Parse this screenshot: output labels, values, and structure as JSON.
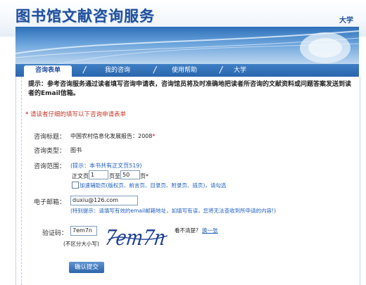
{
  "header": {
    "logo_text": "图书馆文献咨询服务",
    "university_label": "大学"
  },
  "nav": {
    "tabs": [
      {
        "label": "咨询表单",
        "active": true
      },
      {
        "label": "我的咨询",
        "active": false
      },
      {
        "label": "使用帮助",
        "active": false
      },
      {
        "label": "大学",
        "active": false
      }
    ]
  },
  "hint": {
    "text": "提示：参考咨询服务通过读者填写咨询申请表，咨询馆员将及时准确地把读者所咨询的文献资料或问题答案发送到读者的Email信箱。"
  },
  "notice": {
    "asterisk": "*",
    "text": "请读者仔细的填写以下咨询申请表单"
  },
  "form": {
    "title_label": "咨询标题：",
    "title_value": "中国农村信息化发展报告：2008",
    "title_required": "*",
    "type_label": "咨询类型：",
    "type_value": "图书",
    "range_label": "咨询范围：",
    "range_hint": "(提示：本书共有正文页519)",
    "page_prefix": "正文页",
    "page_from": "1",
    "page_to_label": "页至",
    "page_to": "50",
    "page_suffix": "页*",
    "include_aux_label": "加速辅助页(版权页、前言页、目录页、附录页、插页)，请勾选",
    "email_label": "电子邮箱：",
    "email_value": "duxiu@126.com",
    "email_hint": "(特别提示：请填写有效的email邮箱地址，如填写有误，您将无法查收到所申请的内容!)",
    "captcha_label": "验证码：",
    "captcha_value": "7em7n",
    "captcha_case_note": "(不区分大小写)",
    "captcha_image_text": "7em7n",
    "captcha_unclear": "看不清楚?",
    "captcha_refresh": "换一张",
    "submit_label": "确认提交"
  },
  "colors": {
    "brand": "#1f4f9c",
    "nav_bg": "#2a66ad",
    "required": "#d0021b",
    "link": "#1f5fbf"
  }
}
